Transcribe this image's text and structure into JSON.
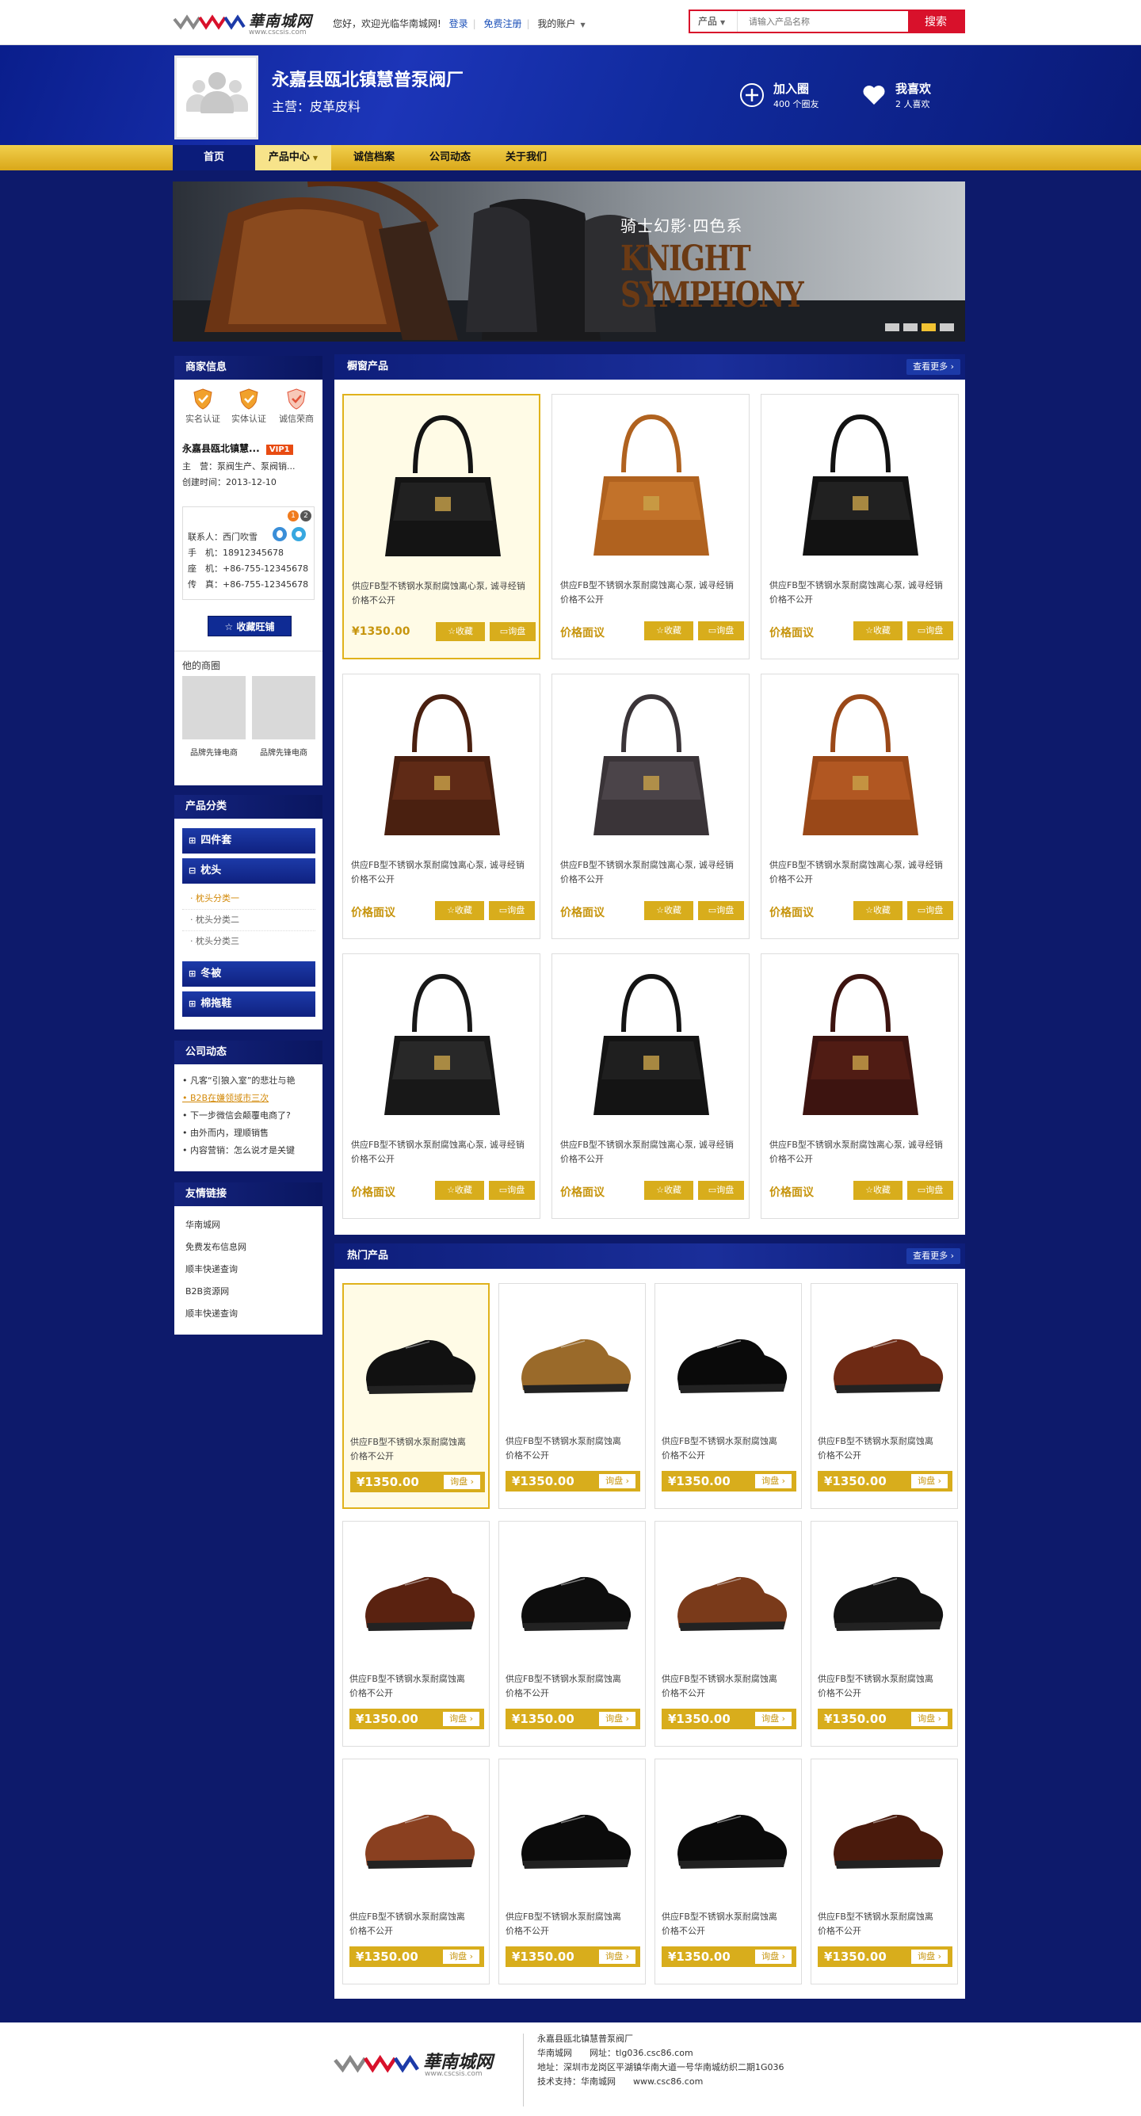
{
  "topbar": {
    "logo_brand": "華南城网",
    "logo_url": "www.cscsis.com",
    "welcome": "您好，欢迎光临华南城网!",
    "login": "登录",
    "register": "免费注册",
    "my_account": "我的账户",
    "search_category": "产品",
    "search_placeholder": "请输入产品名称",
    "search_button": "搜索"
  },
  "header": {
    "company_name": "永嘉县瓯北镇慧普泵阀厂",
    "main_business": "主营：皮革皮料",
    "join_label": "加入圈",
    "join_count": "400 个圈友",
    "like_label": "我喜欢",
    "like_count": "2 人喜欢"
  },
  "nav": [
    "首页",
    "产品中心",
    "诚信档案",
    "公司动态",
    "关于我们"
  ],
  "banner": {
    "subtitle": "骑士幻影·四色系",
    "line1": "KNIGHT",
    "line2": "SYMPHONY"
  },
  "merchant": {
    "title": "商家信息",
    "certs": [
      "实名认证",
      "实体认证",
      "诚信荣商"
    ],
    "name": "永嘉县瓯北镇慧...",
    "vip": "VIP1",
    "main_label": "主　营：",
    "main_value": "泵阀生产、泵阀销...",
    "created_label": "创建时间：",
    "created_value": "2013-12-10",
    "badge1": "1",
    "badge2": "2",
    "contact_label": "联系人：",
    "contact_value": "西门吹雪",
    "mobile_label": "手　机：",
    "mobile_value": "18912345678",
    "phone_label": "座　机：",
    "phone_value": "+86-755-12345678",
    "fax_label": "传　真：",
    "fax_value": "+86-755-12345678",
    "fav_button": "收藏旺铺",
    "shops_title": "他的商圈",
    "shops": [
      "品牌先锋电商",
      "品牌先锋电商"
    ]
  },
  "categories": {
    "title": "产品分类",
    "items": [
      "四件套",
      "枕头"
    ],
    "subitems": [
      "枕头分类一",
      "枕头分类二",
      "枕头分类三"
    ],
    "items2": [
      "冬被",
      "棉拖鞋"
    ]
  },
  "news": {
    "title": "公司动态",
    "items": [
      "凡客“引狼入室”的悲壮与艳",
      "B2B在嫌领域市三次",
      "下一步微信会颠覆电商了?",
      "由外而内，理顺销售",
      "内容营销：怎么说才是关键"
    ]
  },
  "links": {
    "title": "友情链接",
    "items": [
      "华南城网",
      "免费发布信息网",
      "顺丰快递查询",
      "B2B资源网",
      "顺丰快递查询"
    ]
  },
  "showcase": {
    "title": "橱窗产品",
    "more": "查看更多",
    "product_title": "供应FB型不锈钢水泵耐腐蚀离心泵, 诚寻经销",
    "price_hidden": "价格不公开",
    "price_first": "¥1350.00",
    "price_negotiable": "价格面议",
    "fav": "收藏",
    "ask": "询盘"
  },
  "hot": {
    "title": "热门产品",
    "more": "查看更多",
    "product_title": "供应FB型不锈钢水泵耐腐蚀离",
    "price_hidden": "价格不公开",
    "price": "¥1350.00",
    "ask": "询盘"
  },
  "footer": {
    "brand": "華南城网",
    "url": "www.cscsis.com",
    "company": "永嘉县瓯北镇慧普泵阀厂",
    "site": "华南城网　　网址：tlg036.csc86.com",
    "address": "地址：深圳市龙岗区平湖镇华南大道一号华南城纺织二期1G036",
    "support": "技术支持：华南城网　　www.csc86.com"
  },
  "colors": {
    "page_bg": "#0d1a6b",
    "accent_gold": "#d8ad1c",
    "search_red": "#d8112b"
  }
}
